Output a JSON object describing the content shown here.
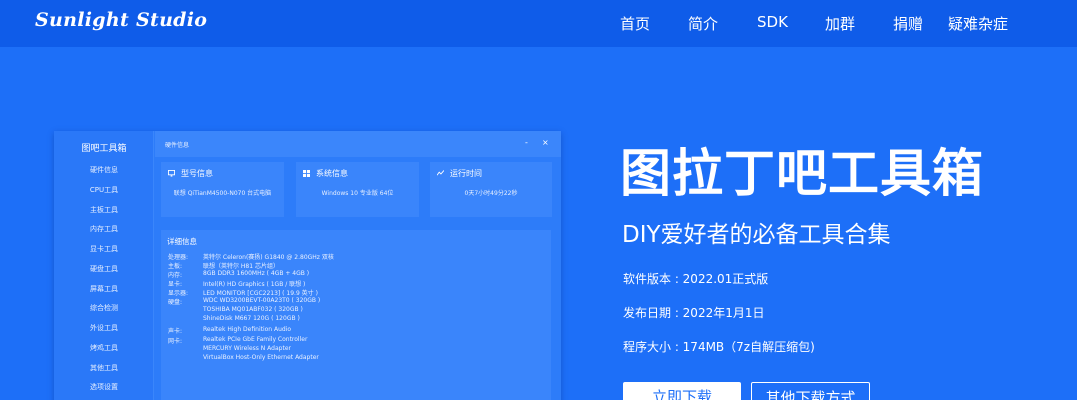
{
  "header": {
    "logo": "Sunlight Studio",
    "nav": [
      "首页",
      "简介",
      "SDK",
      "加群",
      "捐赠",
      "疑难杂症"
    ]
  },
  "app": {
    "sidebar_title": "图吧工具箱",
    "sidebar_items": [
      "硬件信息",
      "CPU工具",
      "主板工具",
      "内存工具",
      "显卡工具",
      "硬盘工具",
      "屏幕工具",
      "综合检测",
      "外设工具",
      "烤鸡工具",
      "其他工具",
      "选项设置"
    ],
    "window_title": "硬件信息",
    "window_controls": [
      "-",
      "×"
    ],
    "cards": [
      {
        "title": "型号信息",
        "value": "联想 QiTianM4500-N070 台式电脑"
      },
      {
        "title": "系统信息",
        "value": "Windows 10 专业版 64位"
      },
      {
        "title": "运行时间",
        "value": "0天7小时49分22秒"
      }
    ],
    "detail_title": "详细信息",
    "details": [
      {
        "k": "处理器:",
        "v": "英特尔 Celeron(赛扬) G1840 @ 2.80GHz 双核"
      },
      {
        "k": "主板:",
        "v": "联想（英特尔 H81 芯片组）"
      },
      {
        "k": "内存:",
        "v": "8GB DDR3 1600MHz ( 4GB + 4GB )"
      },
      {
        "k": "显卡:",
        "v": "Intel(R) HD Graphics ( 1GB / 联想 )"
      },
      {
        "k": "显示器:",
        "v": "LED MONITOR [CGC2213] ( 19.9 英寸 )"
      },
      {
        "k": "硬盘:",
        "v": "WDC WD3200BEVT-00A23T0 ( 320GB )"
      },
      {
        "k": "",
        "v": "TOSHIBA MQ01ABF032 ( 320GB )"
      },
      {
        "k": "",
        "v": "ShineDisk M667 120G ( 120GB )"
      },
      {
        "k": "声卡:",
        "v": "Realtek High Definition Audio"
      },
      {
        "k": "网卡:",
        "v": "Realtek PCIe GbE Family Controller"
      },
      {
        "k": "",
        "v": "MERCURY Wireless N Adapter"
      },
      {
        "k": "",
        "v": "VirtualBox Host-Only Ethernet Adapter"
      }
    ]
  },
  "hero": {
    "title": "图拉丁吧工具箱",
    "subtitle": "DIY爱好者的必备工具合集",
    "version": "软件版本 : 2022.01正式版",
    "date": "发布日期 : 2022年1月1日",
    "size": "程序大小 : 174MB（7z自解压缩包)",
    "btn_download": "立即下载",
    "btn_other": "其他下载方式"
  },
  "colors": {
    "topbar": "#0f5ce9",
    "hero_bg": "#1d6ff8",
    "accent": "#1d6ff8"
  }
}
